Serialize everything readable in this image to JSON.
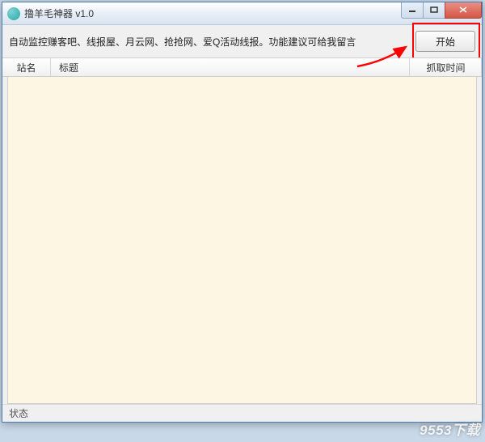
{
  "window": {
    "title": "撸羊毛神器 v1.0"
  },
  "toolbar": {
    "description": "自动监控赚客吧、线报屋、月云网、抢抢网、爱Q活动线报。功能建议可给我留言",
    "start_button": "开始"
  },
  "table": {
    "headers": {
      "site": "站名",
      "title": "标题",
      "time": "抓取时间"
    },
    "rows": []
  },
  "statusbar": {
    "text": "状态"
  },
  "watermark": "9553下载"
}
